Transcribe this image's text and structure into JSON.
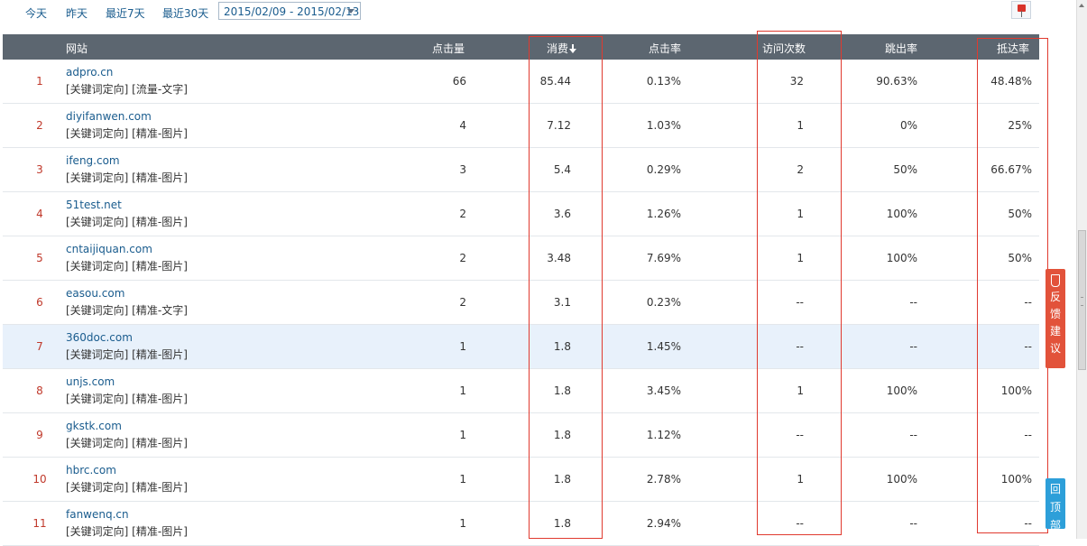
{
  "toolbar": {
    "ranges": [
      "今天",
      "昨天",
      "最近7天",
      "最近30天"
    ],
    "date_range": "2015/02/09 - 2015/02/13"
  },
  "table": {
    "headers": {
      "site": "网站",
      "clicks": "点击量",
      "cost": "消费",
      "ctr": "点击率",
      "visits": "访问次数",
      "bounce": "跳出率",
      "arrival": "抵达率"
    },
    "rows": [
      {
        "num": "1",
        "domain": "adpro.cn",
        "tags": "[关键词定向]  [流量-文字]",
        "clicks": "66",
        "cost": "85.44",
        "ctr": "0.13%",
        "visits": "32",
        "bounce": "90.63%",
        "arrival": "48.48%"
      },
      {
        "num": "2",
        "domain": "diyifanwen.com",
        "tags": "[关键词定向]  [精准-图片]",
        "clicks": "4",
        "cost": "7.12",
        "ctr": "1.03%",
        "visits": "1",
        "bounce": "0%",
        "arrival": "25%"
      },
      {
        "num": "3",
        "domain": "ifeng.com",
        "tags": "[关键词定向]  [精准-图片]",
        "clicks": "3",
        "cost": "5.4",
        "ctr": "0.29%",
        "visits": "2",
        "bounce": "50%",
        "arrival": "66.67%"
      },
      {
        "num": "4",
        "domain": "51test.net",
        "tags": "[关键词定向]  [精准-图片]",
        "clicks": "2",
        "cost": "3.6",
        "ctr": "1.26%",
        "visits": "1",
        "bounce": "100%",
        "arrival": "50%"
      },
      {
        "num": "5",
        "domain": "cntaijiquan.com",
        "tags": "[关键词定向]  [精准-图片]",
        "clicks": "2",
        "cost": "3.48",
        "ctr": "7.69%",
        "visits": "1",
        "bounce": "100%",
        "arrival": "50%"
      },
      {
        "num": "6",
        "domain": "easou.com",
        "tags": "[关键词定向]  [精准-文字]",
        "clicks": "2",
        "cost": "3.1",
        "ctr": "0.23%",
        "visits": "--",
        "bounce": "--",
        "arrival": "--"
      },
      {
        "num": "7",
        "domain": "360doc.com",
        "tags": "[关键词定向]  [精准-图片]",
        "clicks": "1",
        "cost": "1.8",
        "ctr": "1.45%",
        "visits": "--",
        "bounce": "--",
        "arrival": "--"
      },
      {
        "num": "8",
        "domain": "unjs.com",
        "tags": "[关键词定向]  [精准-图片]",
        "clicks": "1",
        "cost": "1.8",
        "ctr": "3.45%",
        "visits": "1",
        "bounce": "100%",
        "arrival": "100%"
      },
      {
        "num": "9",
        "domain": "gkstk.com",
        "tags": "[关键词定向]  [精准-图片]",
        "clicks": "1",
        "cost": "1.8",
        "ctr": "1.12%",
        "visits": "--",
        "bounce": "--",
        "arrival": "--"
      },
      {
        "num": "10",
        "domain": "hbrc.com",
        "tags": "[关键词定向]  [精准-图片]",
        "clicks": "1",
        "cost": "1.8",
        "ctr": "2.78%",
        "visits": "1",
        "bounce": "100%",
        "arrival": "100%"
      },
      {
        "num": "11",
        "domain": "fanwenq.cn",
        "tags": "[关键词定向]  [精准-图片]",
        "clicks": "1",
        "cost": "1.8",
        "ctr": "2.94%",
        "visits": "--",
        "bounce": "--",
        "arrival": "--"
      }
    ]
  },
  "side": {
    "feedback": [
      "反",
      "馈",
      "建",
      "议"
    ],
    "totop": [
      "回",
      "顶",
      "部"
    ]
  },
  "icons": {
    "pin": "pin-icon",
    "sort": "sort-desc-icon",
    "feedback": "pen-icon",
    "dropdown": "chevron-down-icon"
  },
  "colors": {
    "header_bg": "#5c6670",
    "link": "#1a5c8e",
    "index": "#c0392b",
    "highlight_row": "#e8f1fb",
    "annotation_red": "#e03a2f",
    "feedback_bg": "#e2523a",
    "totop_bg": "#2d9fd9"
  }
}
